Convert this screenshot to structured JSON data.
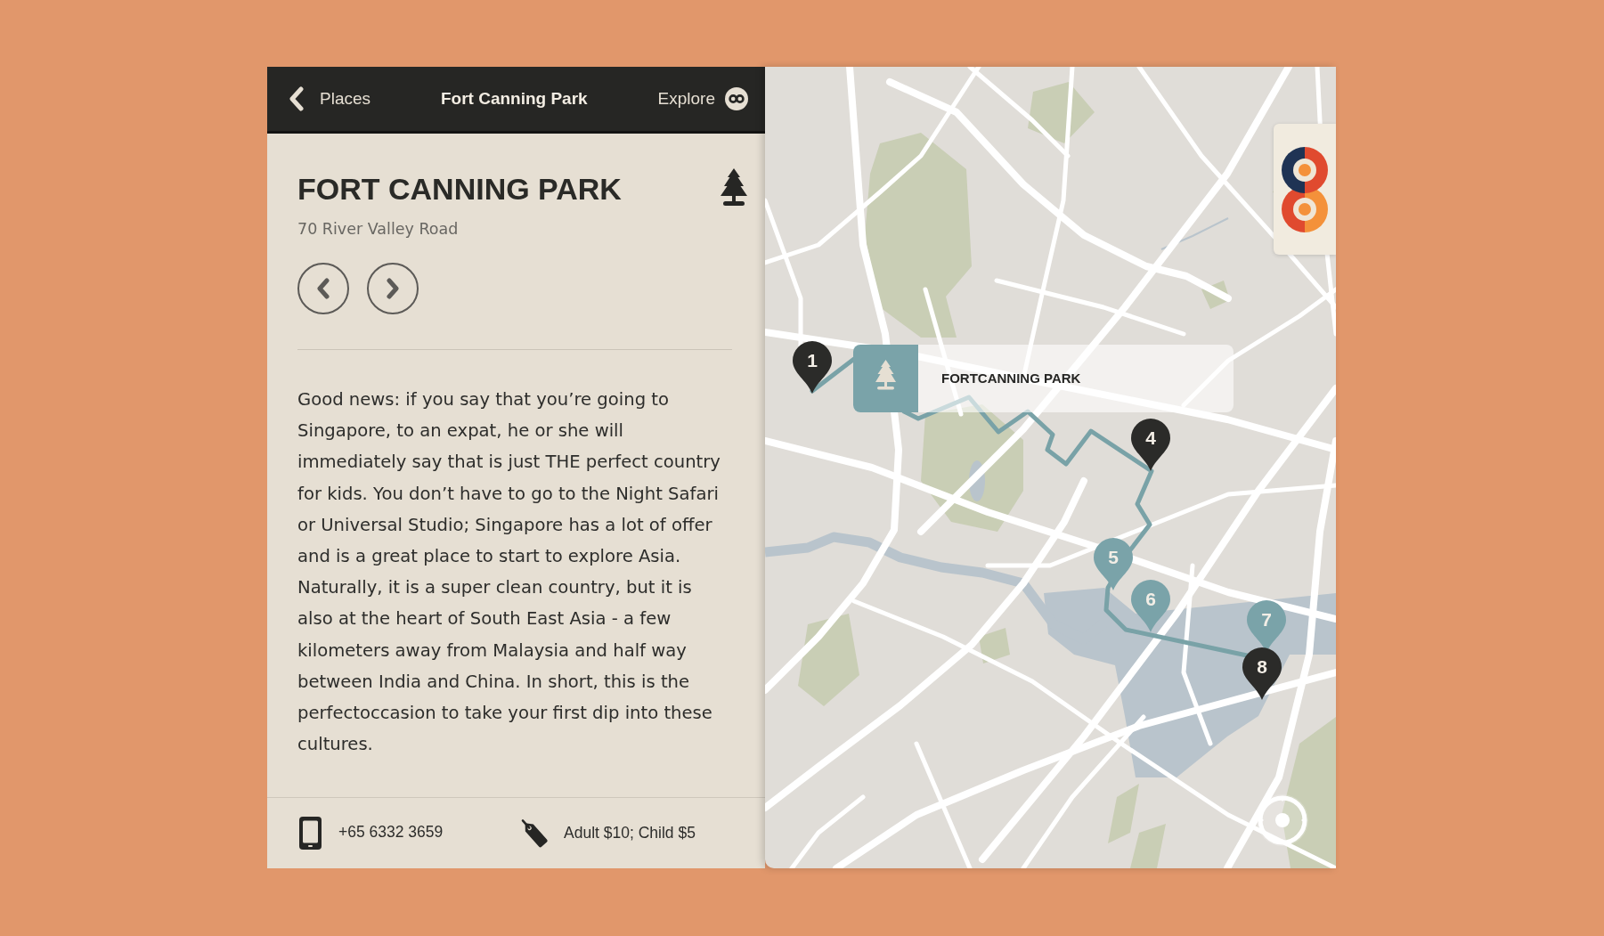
{
  "header": {
    "back_label": "Places",
    "title": "Fort Canning Park",
    "explore_label": "Explore"
  },
  "place": {
    "name": "FORT CANNING PARK",
    "address": "70 River Valley Road",
    "description": "Good news: if you say that you’re going to Singapore, to an expat, he or she will immediately say that is just THE perfect country for kids. You don’t have to go to the Night Safari or Universal Studio; Singapore has a lot of offer and is a great place to start to explore Asia. Naturally, it is a super clean country, but it is also at the heart of South East Asia - a few kilometers away from Malaysia and half way between India and China. In short, this is the perfectoccasion to take your first dip into these cultures."
  },
  "footer": {
    "phone": "+65 6332 3659",
    "price": "Adult $10; Child $5"
  },
  "map": {
    "popup": {
      "title": "FORTCANNING PARK"
    },
    "pins": [
      {
        "label": "1",
        "color": "#2b2b29"
      },
      {
        "label": "4",
        "color": "#2b2b29"
      },
      {
        "label": "5",
        "color": "#7aa3a9"
      },
      {
        "label": "6",
        "color": "#7aa3a9"
      },
      {
        "label": "7",
        "color": "#7aa3a9"
      },
      {
        "label": "8",
        "color": "#2b2b29"
      }
    ]
  }
}
